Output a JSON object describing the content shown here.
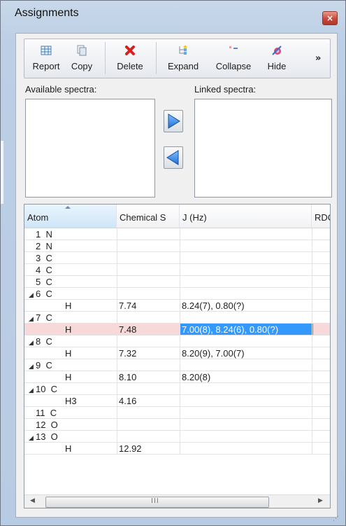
{
  "window": {
    "title": "Assignments",
    "close_symbol": "×"
  },
  "toolbar": {
    "buttons": [
      {
        "label": "Report",
        "icon": "report-grid-icon"
      },
      {
        "label": "Copy",
        "icon": "copy-icon"
      },
      {
        "label": "Delete",
        "icon": "delete-x-icon"
      },
      {
        "label": "Expand",
        "icon": "expand-icon"
      },
      {
        "label": "Collapse",
        "icon": "collapse-icon"
      },
      {
        "label": "Hide",
        "icon": "hide-icon"
      }
    ],
    "overflow": "»"
  },
  "spectra": {
    "available_label": "Available spectra:",
    "linked_label": "Linked spectra:"
  },
  "table": {
    "columns": [
      "Atom",
      "Chemical S",
      "J (Hz)",
      "RDC"
    ],
    "rows": [
      {
        "atom": "1  N",
        "cs": "",
        "j": "",
        "expander": "",
        "child": false
      },
      {
        "atom": "2  N",
        "cs": "",
        "j": "",
        "expander": "",
        "child": false
      },
      {
        "atom": "3  C",
        "cs": "",
        "j": "",
        "expander": "",
        "child": false
      },
      {
        "atom": "4  C",
        "cs": "",
        "j": "",
        "expander": "",
        "child": false
      },
      {
        "atom": "5  C",
        "cs": "",
        "j": "",
        "expander": "",
        "child": false
      },
      {
        "atom": "6  C",
        "cs": "",
        "j": "",
        "expander": "◢",
        "child": false
      },
      {
        "atom": "H",
        "cs": "7.74",
        "j": "8.24(7), 0.80(?)",
        "expander": "",
        "child": true
      },
      {
        "atom": "7  C",
        "cs": "",
        "j": "",
        "expander": "◢",
        "child": false
      },
      {
        "atom": "H",
        "cs": "7.48",
        "j": "7.00(8), 8.24(6), 0.80(?)",
        "expander": "",
        "child": true,
        "selected": true
      },
      {
        "atom": "8  C",
        "cs": "",
        "j": "",
        "expander": "◢",
        "child": false
      },
      {
        "atom": "H",
        "cs": "7.32",
        "j": "8.20(9), 7.00(7)",
        "expander": "",
        "child": true
      },
      {
        "atom": "9  C",
        "cs": "",
        "j": "",
        "expander": "◢",
        "child": false
      },
      {
        "atom": "H",
        "cs": "8.10",
        "j": "8.20(8)",
        "expander": "",
        "child": true
      },
      {
        "atom": "10  C",
        "cs": "",
        "j": "",
        "expander": "◢",
        "child": false
      },
      {
        "atom": "H3",
        "cs": "4.16",
        "j": "",
        "expander": "",
        "child": true
      },
      {
        "atom": "11  C",
        "cs": "",
        "j": "",
        "expander": "",
        "child": false
      },
      {
        "atom": "12  O",
        "cs": "",
        "j": "",
        "expander": "",
        "child": false
      },
      {
        "atom": "13  O",
        "cs": "",
        "j": "",
        "expander": "◢",
        "child": false
      },
      {
        "atom": "H",
        "cs": "12.92",
        "j": "",
        "expander": "",
        "child": true
      }
    ]
  },
  "scrollbar": {
    "left_arrow": "◀",
    "right_arrow": "▶",
    "grip": "III"
  },
  "colors": {
    "selected_row": "#f7d9d9",
    "highlight_cell": "#3399ff",
    "arrow_blue": "#1f6fd6"
  }
}
